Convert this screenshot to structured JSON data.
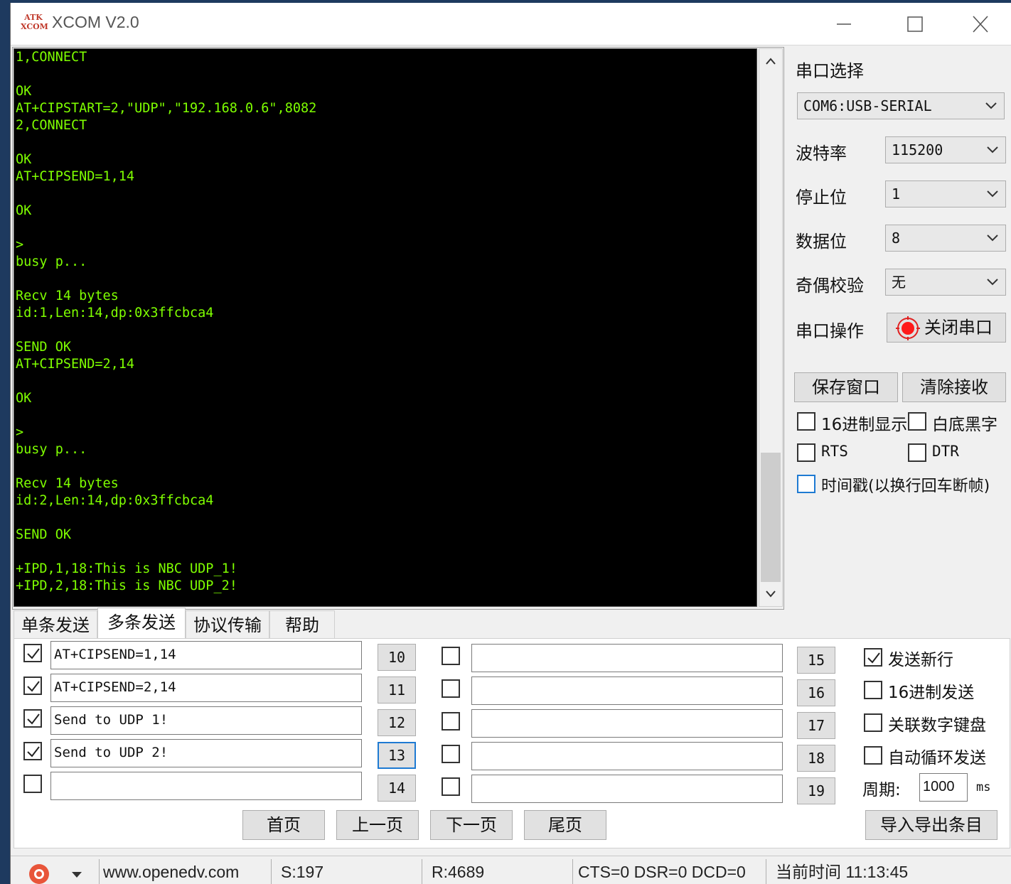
{
  "window": {
    "logo": "ATK\nXCOM",
    "title": "XCOM V2.0",
    "minimize_icon": "minimize-icon",
    "maximize_icon": "maximize-icon",
    "close_icon": "close-icon"
  },
  "terminal": {
    "lines": [
      "1,CONNECT",
      "",
      "OK",
      "AT+CIPSTART=2,\"UDP\",\"192.168.0.6\",8082",
      "2,CONNECT",
      "",
      "OK",
      "AT+CIPSEND=1,14",
      "",
      "OK",
      "",
      ">",
      "busy p...",
      "",
      "Recv 14 bytes",
      "id:1,Len:14,dp:0x3ffcbca4",
      "",
      "SEND OK",
      "AT+CIPSEND=2,14",
      "",
      "OK",
      "",
      ">",
      "busy p...",
      "",
      "Recv 14 bytes",
      "id:2,Len:14,dp:0x3ffcbca4",
      "",
      "SEND OK",
      "",
      "+IPD,1,18:This is NBC UDP_1!",
      "+IPD,2,18:This is NBC UDP_2!"
    ],
    "text_color": "#7fff00"
  },
  "settings": {
    "port_select_label": "串口选择",
    "port_value": "COM6:USB-SERIAL",
    "baud_label": "波特率",
    "baud_value": "115200",
    "stop_label": "停止位",
    "stop_value": "1",
    "data_label": "数据位",
    "data_value": "8",
    "parity_label": "奇偶校验",
    "parity_value": "无",
    "op_label": "串口操作",
    "close_port_button": "关闭串口",
    "save_window_button": "保存窗口",
    "clear_recv_button": "清除接收",
    "hex_display": {
      "label": "16进制显示",
      "checked": false
    },
    "white_bg": {
      "label": "白底黑字",
      "checked": false
    },
    "rts": {
      "label": "RTS",
      "checked": false
    },
    "dtr": {
      "label": "DTR",
      "checked": false
    },
    "timestamp": {
      "label": "时间戳(以换行回车断帧)",
      "checked": false
    }
  },
  "tabs": [
    {
      "label": "单条发送",
      "active": false
    },
    {
      "label": "多条发送",
      "active": true
    },
    {
      "label": "协议传输",
      "active": false
    },
    {
      "label": "帮助",
      "active": false
    }
  ],
  "multi_send": {
    "left_rows": [
      {
        "checked": true,
        "text": "AT+CIPSEND=1,14",
        "num": "10"
      },
      {
        "checked": true,
        "text": "AT+CIPSEND=2,14",
        "num": "11"
      },
      {
        "checked": true,
        "text": "Send to UDP 1!",
        "num": "12"
      },
      {
        "checked": true,
        "text": "Send to UDP 2!",
        "num": "13"
      },
      {
        "checked": false,
        "text": "",
        "num": "14"
      }
    ],
    "right_rows": [
      {
        "checked": false,
        "text": "",
        "num": "15"
      },
      {
        "checked": false,
        "text": "",
        "num": "16"
      },
      {
        "checked": false,
        "text": "",
        "num": "17"
      },
      {
        "checked": false,
        "text": "",
        "num": "18"
      },
      {
        "checked": false,
        "text": "",
        "num": "19"
      }
    ],
    "send_newline": {
      "label": "发送新行",
      "checked": true
    },
    "hex_send": {
      "label": "16进制发送",
      "checked": false
    },
    "link_keypad": {
      "label": "关联数字键盘",
      "checked": false
    },
    "auto_loop": {
      "label": "自动循环发送",
      "checked": false
    },
    "period_label": "周期:",
    "period_value": "1000",
    "period_unit": "ms",
    "first_page": "首页",
    "prev_page": "上一页",
    "next_page": "下一页",
    "last_page": "尾页",
    "import_export": "导入导出条目"
  },
  "status": {
    "url": "www.openedv.com",
    "sent": "S:197",
    "received": "R:4689",
    "lines": "CTS=0 DSR=0 DCD=0",
    "time": "当前时间 11:13:45"
  }
}
